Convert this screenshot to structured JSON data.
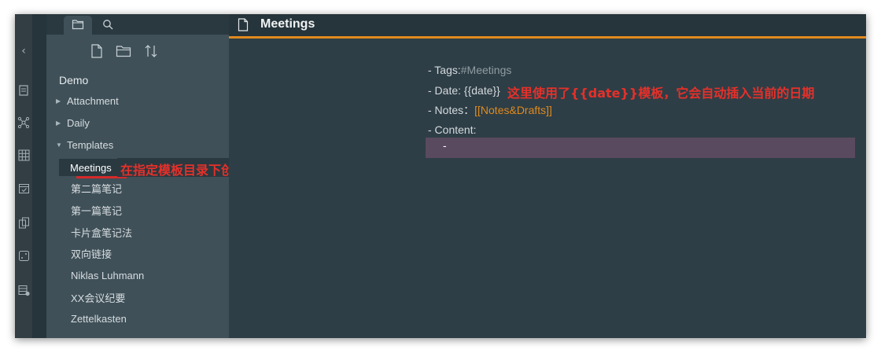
{
  "sidebar": {
    "vault_name": "Demo",
    "tree": [
      {
        "label": "Attachment",
        "type": "folder",
        "expanded": false
      },
      {
        "label": "Daily",
        "type": "folder",
        "expanded": false
      },
      {
        "label": "Templates",
        "type": "folder",
        "expanded": true
      }
    ],
    "selected_file": "Meetings",
    "files": [
      "第二篇笔记",
      "第一篇笔记",
      "卡片盒笔记法",
      "双向链接",
      "Niklas Luhmann",
      "XX会议纪要",
      "Zettelkasten"
    ]
  },
  "annotations": {
    "sidebar_note": "在指定模板目录下创建模板文件",
    "date_note": "这里使用了{{date}}模板，它会自动插入当前的日期"
  },
  "editor": {
    "title": "Meetings",
    "lines": {
      "tags_label": "- Tags: ",
      "tags_value": "#Meetings",
      "date_label": "- Date: {{date}}",
      "notes_label": "- Notes：",
      "notes_link": "[[Notes&Drafts]]",
      "content_label": "- Content:",
      "highlight_text": "-"
    }
  },
  "colors": {
    "accent": "#e08a1e",
    "annotation": "#e6302a",
    "highlight": "#5a4a5f"
  },
  "icons": [
    "collapse-icon",
    "folder-tab-icon",
    "search-tab-icon",
    "new-note-icon",
    "new-folder-icon",
    "sort-icon",
    "file-icon",
    "open-note-icon",
    "graph-icon",
    "grid-icon",
    "calendar-icon",
    "copy-icon",
    "dice-icon",
    "table-icon"
  ]
}
